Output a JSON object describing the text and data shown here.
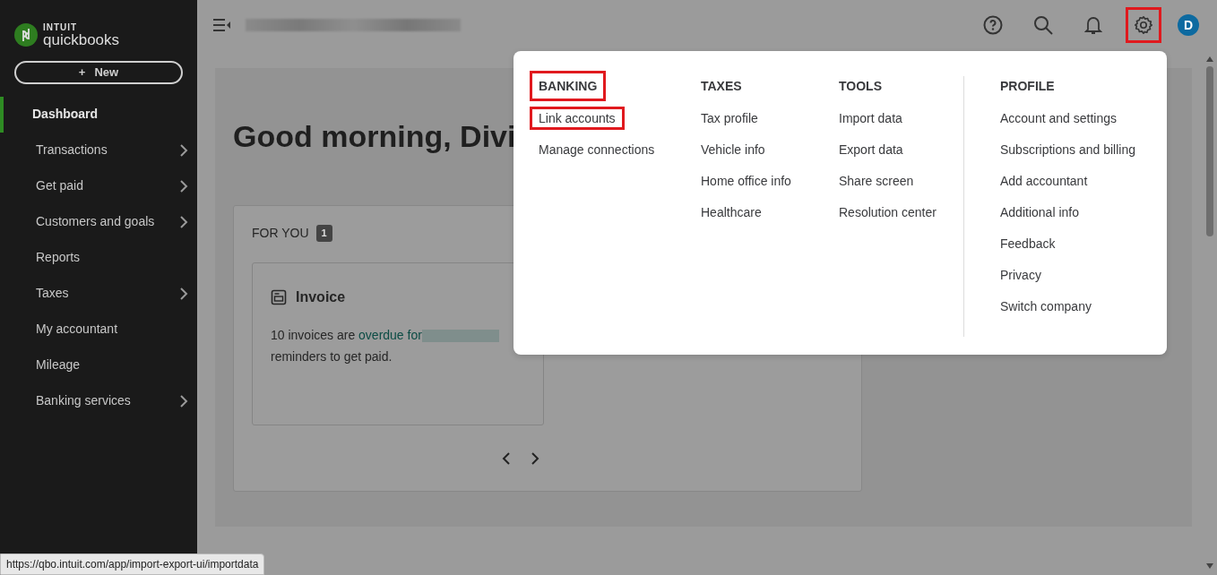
{
  "sidebar": {
    "logo": {
      "brand_small": "INTUIT",
      "brand": "quickbooks"
    },
    "new_button": {
      "icon": "+",
      "label": "New"
    },
    "items": [
      {
        "label": "Dashboard",
        "selected": true,
        "has_submenu": false
      },
      {
        "label": "Transactions",
        "selected": false,
        "has_submenu": true
      },
      {
        "label": "Get paid",
        "selected": false,
        "has_submenu": true
      },
      {
        "label": "Customers and goals",
        "selected": false,
        "has_submenu": true
      },
      {
        "label": "Reports",
        "selected": false,
        "has_submenu": false
      },
      {
        "label": "Taxes",
        "selected": false,
        "has_submenu": true
      },
      {
        "label": "My accountant",
        "selected": false,
        "has_submenu": false
      },
      {
        "label": "Mileage",
        "selected": false,
        "has_submenu": false
      },
      {
        "label": "Banking services",
        "selected": false,
        "has_submenu": true
      }
    ]
  },
  "topbar": {
    "avatar": "D",
    "settings_highlighted": true
  },
  "main": {
    "greeting": "Good morning, Divi",
    "for_you": {
      "title": "FOR YOU",
      "count": "1",
      "card": {
        "title": "Invoice",
        "text_before": "10 invoices are ",
        "link": "overdue for",
        "text_after": "reminders to get paid."
      }
    }
  },
  "settings_menu": {
    "columns": [
      {
        "heading": "BANKING",
        "highlighted": true,
        "divider_before": false,
        "items": [
          {
            "label": "Link accounts",
            "highlighted": true
          },
          {
            "label": "Manage connections",
            "highlighted": false
          }
        ]
      },
      {
        "heading": "TAXES",
        "highlighted": false,
        "divider_before": false,
        "items": [
          {
            "label": "Tax profile",
            "highlighted": false
          },
          {
            "label": "Vehicle info",
            "highlighted": false
          },
          {
            "label": "Home office info",
            "highlighted": false
          },
          {
            "label": "Healthcare",
            "highlighted": false
          }
        ]
      },
      {
        "heading": "TOOLS",
        "highlighted": false,
        "divider_before": false,
        "items": [
          {
            "label": "Import data",
            "highlighted": false
          },
          {
            "label": "Export data",
            "highlighted": false
          },
          {
            "label": "Share screen",
            "highlighted": false
          },
          {
            "label": "Resolution center",
            "highlighted": false
          }
        ]
      },
      {
        "heading": "PROFILE",
        "highlighted": false,
        "divider_before": true,
        "items": [
          {
            "label": "Account and settings",
            "highlighted": false
          },
          {
            "label": "Subscriptions and billing",
            "highlighted": false
          },
          {
            "label": "Add accountant",
            "highlighted": false
          },
          {
            "label": "Additional info",
            "highlighted": false
          },
          {
            "label": "Feedback",
            "highlighted": false
          },
          {
            "label": "Privacy",
            "highlighted": false
          },
          {
            "label": "Switch company",
            "highlighted": false
          }
        ]
      }
    ]
  },
  "status_url": "https://qbo.intuit.com/app/import-export-ui/importdata"
}
